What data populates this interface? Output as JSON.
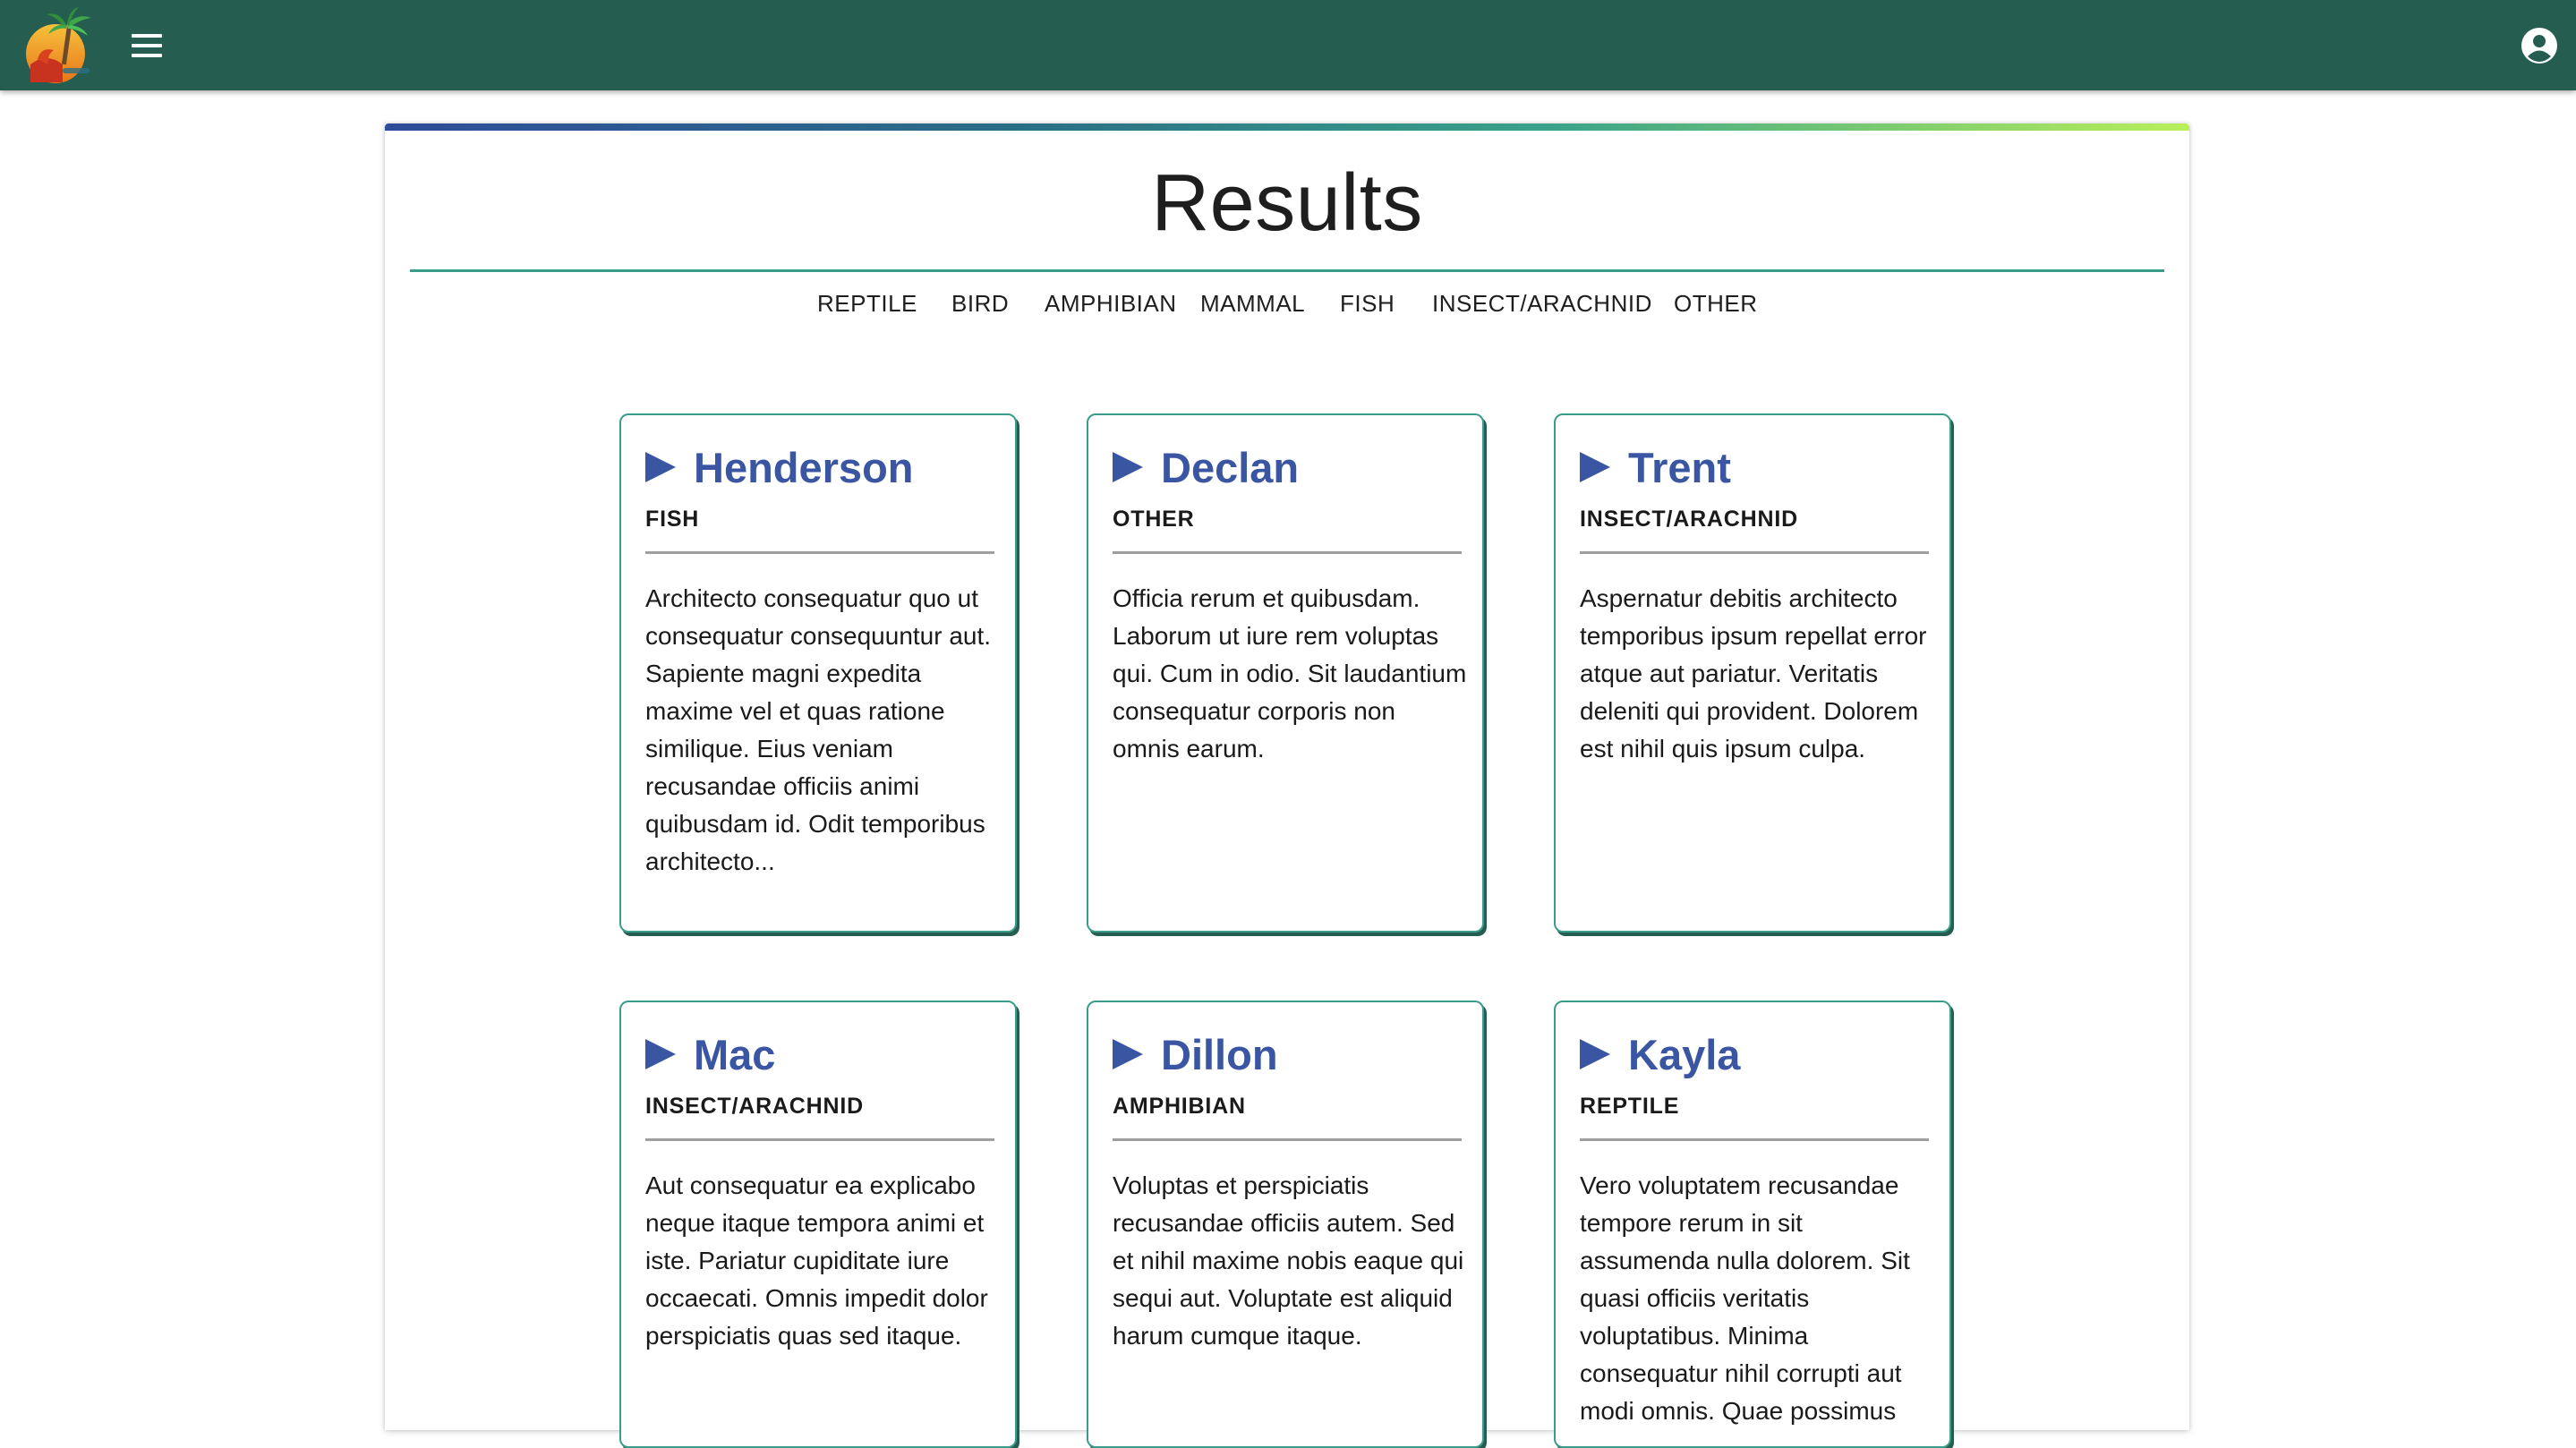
{
  "app": {
    "logo_icon": "island-logo-icon",
    "menu_icon": "hamburger-menu-icon",
    "account_icon": "account-circle-icon",
    "bar_color": "#255e51"
  },
  "page": {
    "title": "Results",
    "accent_color": "#3a9d8b",
    "name_color": "#3a56a3"
  },
  "filters": [
    "REPTILE",
    "BIRD",
    "AMPHIBIAN",
    "MAMMAL",
    "FISH",
    "INSECT/ARACHNID",
    "OTHER"
  ],
  "cards": [
    {
      "name": "Henderson",
      "category": "FISH",
      "description": "Architecto consequatur quo ut consequatur consequuntur aut. Sapiente magni expedita maxime vel et quas ratione similique. Eius veniam recusandae officiis animi quibusdam id. Odit temporibus architecto..."
    },
    {
      "name": "Declan",
      "category": "OTHER",
      "description": "Officia rerum et quibusdam. Laborum ut iure rem voluptas qui. Cum in odio. Sit laudantium consequatur corporis non omnis earum."
    },
    {
      "name": "Trent",
      "category": "INSECT/ARACHNID",
      "description": "Aspernatur debitis architecto temporibus ipsum repellat error atque aut pariatur. Veritatis deleniti qui provident. Dolorem est nihil quis ipsum culpa."
    },
    {
      "name": "Mac",
      "category": "INSECT/ARACHNID",
      "description": "Aut consequatur ea explicabo neque itaque tempora animi et iste. Pariatur cupiditate iure occaecati. Omnis impedit dolor perspiciatis quas sed itaque."
    },
    {
      "name": "Dillon",
      "category": "AMPHIBIAN",
      "description": "Voluptas et perspiciatis recusandae officiis autem. Sed et nihil maxime nobis eaque qui sequi aut. Voluptate est aliquid harum cumque itaque."
    },
    {
      "name": "Kayla",
      "category": "REPTILE",
      "description": "Vero voluptatem recusandae tempore rerum in sit assumenda nulla dolorem. Sit quasi officiis veritatis voluptatibus. Minima consequatur nihil corrupti aut modi omnis. Quae possimus"
    }
  ]
}
